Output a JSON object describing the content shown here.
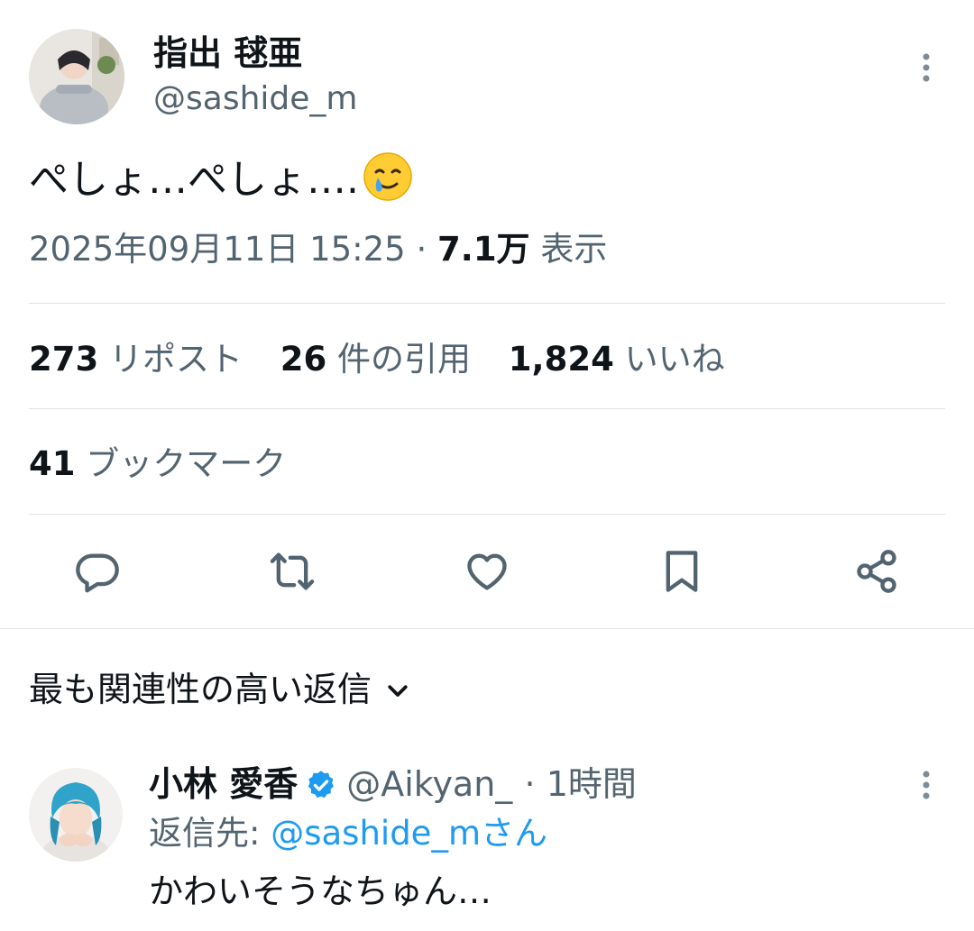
{
  "tweet": {
    "author_name": "指出 毬亜",
    "author_handle": "@sashide_m",
    "text": "ぺしょ…ぺしょ….",
    "emoji": "smiling-face-with-tear",
    "timestamp": "2025年09月11日 15:25",
    "dot": "·",
    "views_value": "7.1万",
    "views_label": "表示"
  },
  "stats": {
    "reposts_value": "273",
    "reposts_label": "リポスト",
    "quotes_value": "26",
    "quotes_label": "件の引用",
    "likes_value": "1,824",
    "likes_label": "いいね",
    "bookmarks_value": "41",
    "bookmarks_label": "ブックマーク"
  },
  "actions": [
    "reply-icon",
    "repost-icon",
    "like-icon",
    "bookmark-icon",
    "share-icon"
  ],
  "replies_section": {
    "sort_label": "最も関連性の高い返信"
  },
  "reply": {
    "author_name": "小林 愛香",
    "author_handle": "@Aikyan_",
    "time": "· 1時間",
    "reply_to_prefix": "返信先:",
    "reply_to_handle": "@sashide_mさん",
    "text": "かわいそうなちゅん…"
  },
  "colors": {
    "text": "#0f1419",
    "secondary": "#536471",
    "link": "#1d9bf0",
    "divider": "#dfe3e6",
    "verified": "#1d9bf0"
  }
}
